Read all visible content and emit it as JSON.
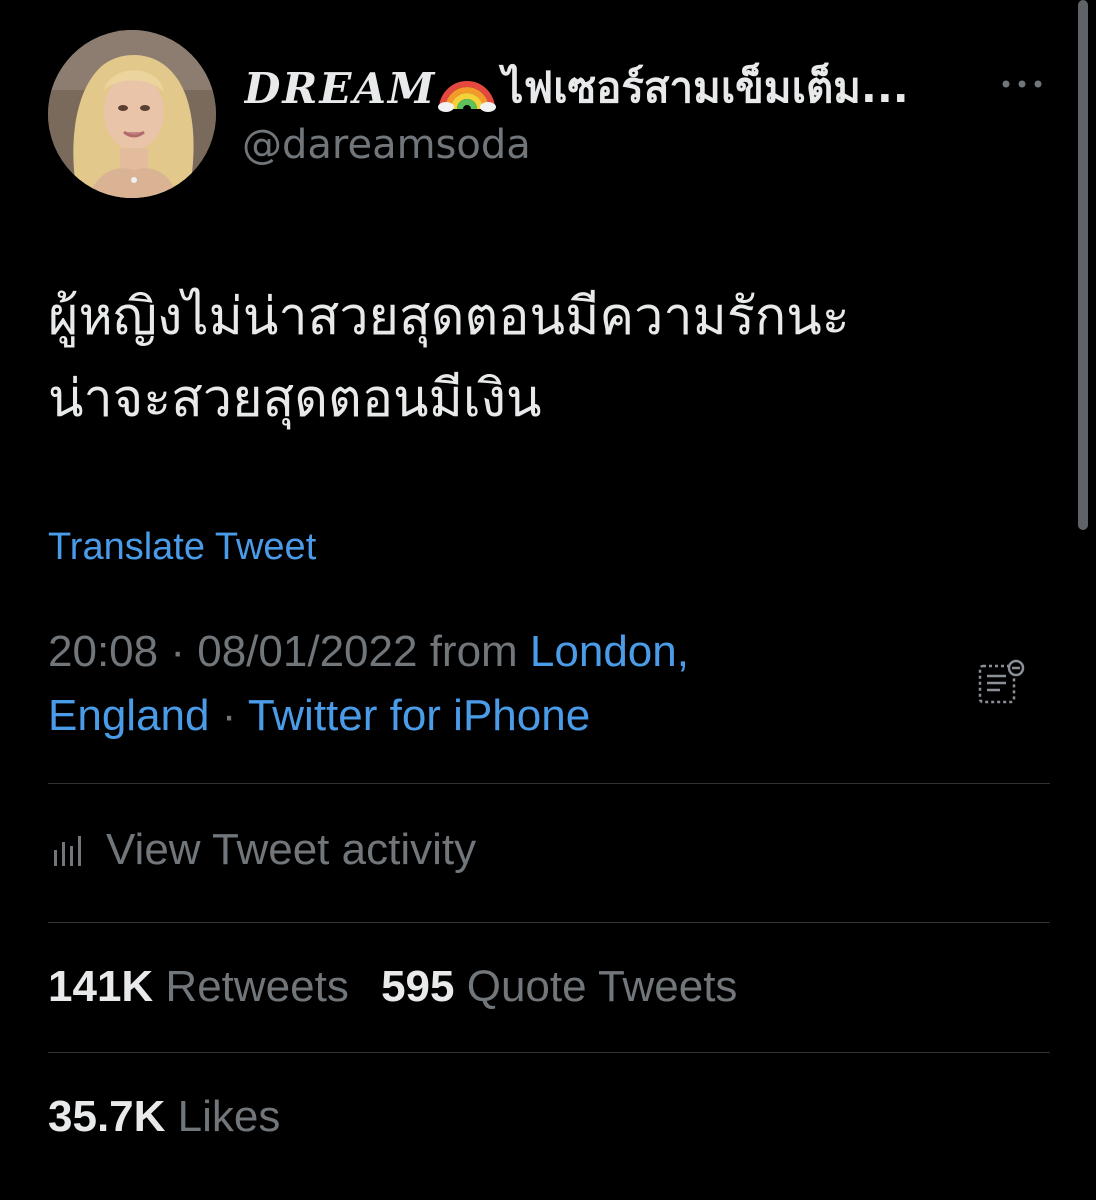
{
  "author": {
    "display_name_prefix": "DREAM",
    "display_name_emoji": "rainbow-emoji",
    "display_name_suffix": "ไฟเซอร์สามเข็มเต็ม...",
    "handle": "@dareamsoda"
  },
  "tweet": {
    "lines": [
      "ผู้หญิงไม่น่าสวยสุดตอนมีความรักนะ",
      "น่าจะสวยสุดตอนมีเงิน"
    ],
    "translate_label": "Translate Tweet",
    "time": "20:08",
    "separator": "·",
    "date": "08/01/2022",
    "from_label": "from",
    "location_line1": "London,",
    "location_line2": "England",
    "client": "Twitter for iPhone"
  },
  "activity": {
    "label": "View Tweet activity",
    "icon": "bar-chart-icon"
  },
  "stats": {
    "retweets_count": "141K",
    "retweets_label": "Retweets",
    "quotes_count": "595",
    "quotes_label": "Quote Tweets",
    "likes_count": "35.7K",
    "likes_label": "Likes"
  },
  "icons": {
    "more": "more-horizontal-icon",
    "notes": "community-notes-icon"
  },
  "colors": {
    "background": "#000000",
    "primary_text": "#e7e9ea",
    "secondary_text": "#71767b",
    "link": "#4a9ce8",
    "divider": "#2f3336"
  }
}
